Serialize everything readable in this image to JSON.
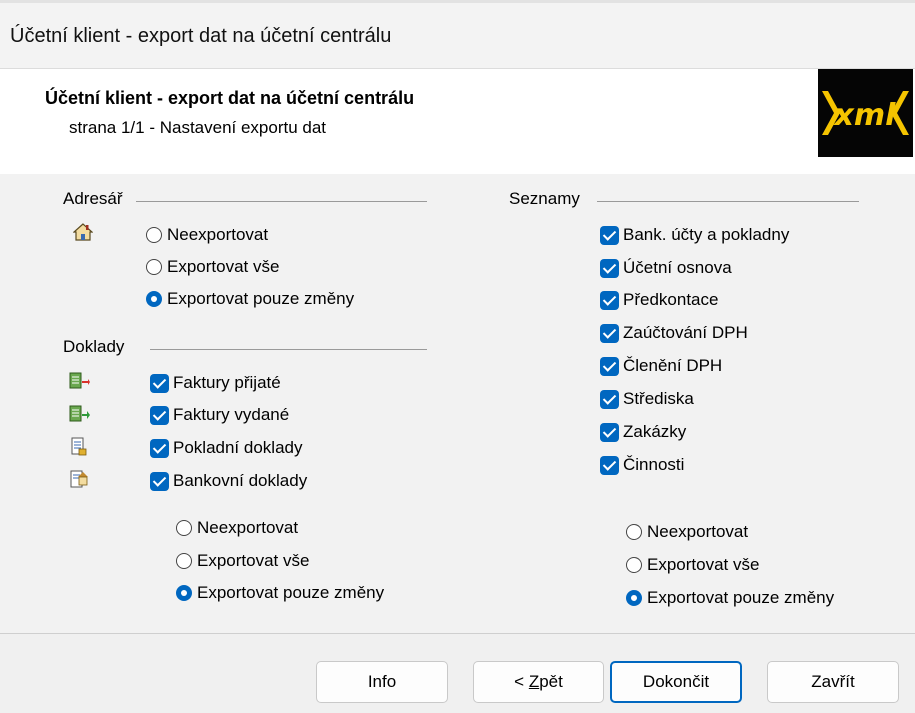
{
  "window": {
    "title": "Účetní klient - export dat na účetní centrálu"
  },
  "header": {
    "title": "Účetní klient - export dat na účetní centrálu",
    "subtitle": "strana 1/1 - Nastavení exportu dat",
    "logo_text": "xml"
  },
  "adresar": {
    "label": "Adresář",
    "icon": "house-icon",
    "options": [
      "Neexportovat",
      "Exportovat vše",
      "Exportovat pouze změny"
    ],
    "selected": "Exportovat pouze změny"
  },
  "doklady": {
    "label": "Doklady",
    "items": [
      {
        "label": "Faktury přijaté",
        "checked": true,
        "icon": "invoice-received-icon"
      },
      {
        "label": "Faktury vydané",
        "checked": true,
        "icon": "invoice-issued-icon"
      },
      {
        "label": "Pokladní doklady",
        "checked": true,
        "icon": "cash-document-icon"
      },
      {
        "label": "Bankovní doklady",
        "checked": true,
        "icon": "bank-document-icon"
      }
    ],
    "options": [
      "Neexportovat",
      "Exportovat vše",
      "Exportovat pouze změny"
    ],
    "selected": "Exportovat pouze změny"
  },
  "seznamy": {
    "label": "Seznamy",
    "items": [
      {
        "label": "Bank. účty a pokladny",
        "checked": true
      },
      {
        "label": "Účetní osnova",
        "checked": true
      },
      {
        "label": "Předkontace",
        "checked": true
      },
      {
        "label": "Zaúčtování DPH",
        "checked": true
      },
      {
        "label": "Členění DPH",
        "checked": true
      },
      {
        "label": "Střediska",
        "checked": true
      },
      {
        "label": "Zakázky",
        "checked": true
      },
      {
        "label": "Činnosti",
        "checked": true
      }
    ],
    "options": [
      "Neexportovat",
      "Exportovat vše",
      "Exportovat pouze změny"
    ],
    "selected": "Exportovat pouze změny"
  },
  "footer": {
    "info": "Info",
    "back_prefix": "< ",
    "back_underlined": "Z",
    "back_rest": "pět",
    "finish": "Dokončit",
    "close": "Zavřít"
  },
  "colors": {
    "accent": "#0067c0",
    "panel": "#f2f2f2",
    "logo_bg": "#050505",
    "logo_fg": "#f5c400"
  }
}
